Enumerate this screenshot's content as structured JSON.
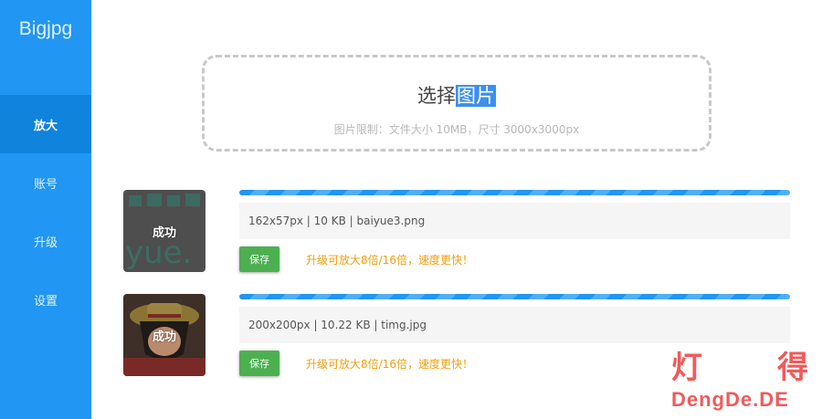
{
  "app": {
    "logo": "Bigjpg"
  },
  "sidebar": {
    "items": [
      {
        "label": "放大",
        "active": true
      },
      {
        "label": "账号",
        "active": false
      },
      {
        "label": "升级",
        "active": false
      },
      {
        "label": "设置",
        "active": false
      }
    ]
  },
  "upload": {
    "title_prefix": "选择",
    "title_highlight": "图片",
    "hint": "图片限制：文件大小 10MB，尺寸 3000x3000px"
  },
  "results": [
    {
      "status": "成功",
      "info": "162x57px | 10 KB | baiyue3.png",
      "save_label": "保存",
      "upgrade_text": "升级可放大8倍/16倍，速度更快！",
      "progress": 1.0
    },
    {
      "status": "成功",
      "info": "200x200px | 10.22 KB | timg.jpg",
      "save_label": "保存",
      "upgrade_text": "升级可放大8倍/16倍，速度更快！",
      "progress": 1.0
    }
  ],
  "thumbnail_text": "yue.",
  "watermark": {
    "chars": [
      "灯",
      "得"
    ],
    "domain": "DengDe.DE"
  },
  "colors": {
    "sidebar": "#2196f3",
    "sidebar_active": "#1083dc",
    "progress": "#2196f3",
    "save": "#4caf50",
    "upgrade": "#f59e0b",
    "watermark": "#f25a5a"
  }
}
